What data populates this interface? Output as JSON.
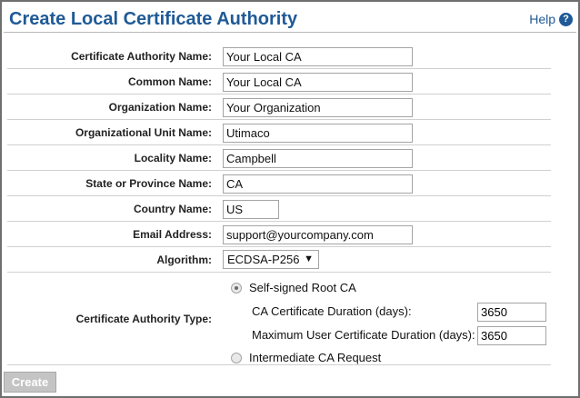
{
  "header": {
    "title": "Create Local Certificate Authority",
    "help_label": "Help",
    "help_icon": "?"
  },
  "fields": [
    {
      "label": "Certificate Authority Name:",
      "value": "Your Local CA"
    },
    {
      "label": "Common Name:",
      "value": "Your Local CA"
    },
    {
      "label": "Organization Name:",
      "value": "Your Organization"
    },
    {
      "label": "Organizational Unit Name:",
      "value": "Utimaco"
    },
    {
      "label": "Locality Name:",
      "value": "Campbell"
    },
    {
      "label": "State or Province Name:",
      "value": "CA"
    },
    {
      "label": "Country Name:",
      "value": "US"
    },
    {
      "label": "Email Address:",
      "value": "support@yourcompany.com"
    }
  ],
  "algorithm": {
    "label": "Algorithm:",
    "selected": "ECDSA-P256",
    "arrow": "▼"
  },
  "ca_type": {
    "label": "Certificate Authority Type:",
    "option_root": "Self-signed Root CA",
    "option_root_checked": true,
    "ca_duration_label": "CA Certificate Duration (days):",
    "ca_duration_value": "3650",
    "user_duration_label": "Maximum User Certificate Duration (days):",
    "user_duration_value": "3650",
    "option_intermediate": "Intermediate CA Request",
    "option_intermediate_checked": false
  },
  "actions": {
    "create_label": "Create"
  },
  "colors": {
    "title": "#1f5a96",
    "button_disabled": "#c4c4c4"
  }
}
